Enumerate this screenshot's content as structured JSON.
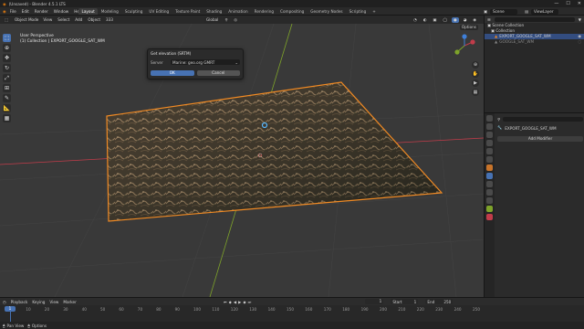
{
  "window": {
    "title": "(Unsaved) - Blender 4.5.1 LTS",
    "minimize_glyph": "—",
    "maximize_glyph": "☐",
    "close_glyph": "✕"
  },
  "menu": [
    "File",
    "Edit",
    "Render",
    "Window",
    "Help"
  ],
  "workspaces": [
    "Layout",
    "Modeling",
    "Sculpting",
    "UV Editing",
    "Texture Paint",
    "Shading",
    "Animation",
    "Rendering",
    "Compositing",
    "Geometry Nodes",
    "Scripting"
  ],
  "active_workspace": "Layout",
  "scene": {
    "name": "Scene",
    "view_layer": "ViewLayer"
  },
  "viewport_header": {
    "mode": "Object Mode",
    "menus": [
      "View",
      "Select",
      "Add",
      "Object",
      "333"
    ],
    "orientation": "Global",
    "options_label": "Options"
  },
  "viewport_info": {
    "line1": "User Perspective",
    "line2": "(1) Collection | EXPORT_GOOGLE_SAT_WM"
  },
  "dialog": {
    "title": "Get elevation (SRTM)",
    "server_label": "Server",
    "server_value": "Marine: geo.org GMRT",
    "ok_label": "OK",
    "cancel_label": "Cancel"
  },
  "outliner": {
    "root": "Scene Collection",
    "collection": "Collection",
    "items": [
      "EXPORT_GOOGLE_SAT_WM",
      "GOOGLE_SAT_WM"
    ]
  },
  "properties": {
    "object_name": "EXPORT_GOOGLE_SAT_WM",
    "add_modifier_label": "Add Modifier"
  },
  "timeline": {
    "menus": [
      "Playback",
      "Keying",
      "View",
      "Marker"
    ],
    "current_frame": "1",
    "start_label": "Start",
    "start_value": "1",
    "end_label": "End",
    "end_value": "250",
    "ticks": [
      "0",
      "10",
      "20",
      "30",
      "40",
      "50",
      "60",
      "70",
      "80",
      "90",
      "100",
      "110",
      "120",
      "130",
      "140",
      "150",
      "160",
      "170",
      "180",
      "190",
      "200",
      "210",
      "220",
      "230",
      "240",
      "250"
    ]
  },
  "statusbar": {
    "left_label": "Pan View",
    "right_label": "Options"
  },
  "colors": {
    "accent": "#4772b3",
    "selection_outline": "#f08a24",
    "x_axis": "#c23c4a",
    "y_axis": "#7ea32a"
  }
}
